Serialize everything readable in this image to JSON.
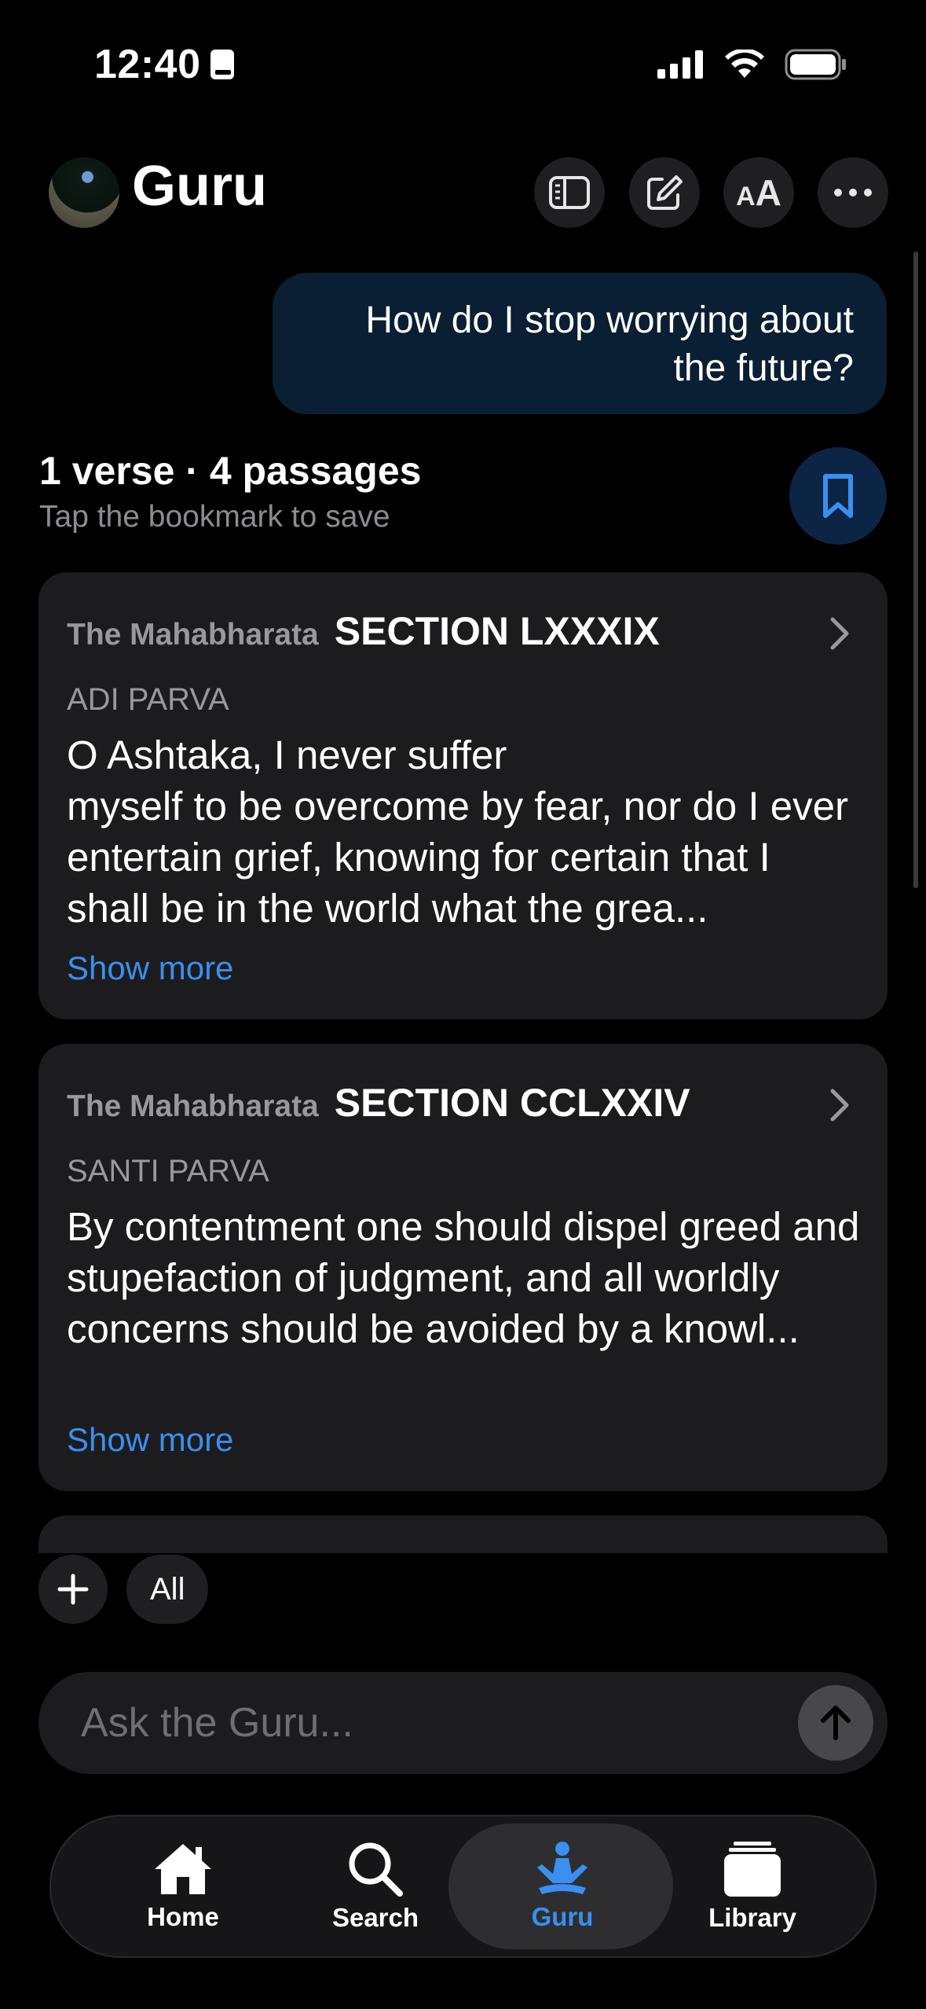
{
  "status_bar": {
    "time": "12:40"
  },
  "header": {
    "title": "Guru",
    "buttons": [
      "sidebar-icon",
      "compose-icon",
      "text-size-icon",
      "more-icon"
    ],
    "text_size_label": "AA"
  },
  "conversation": {
    "user_message": "How do I stop worrying about the future?"
  },
  "results": {
    "summary": "1 verse · 4 passages",
    "hint": "Tap the bookmark to save",
    "cards": [
      {
        "book": "The Mahabharata",
        "section": "SECTION LXXXIX",
        "parva": "ADI PARVA",
        "text": "O Ashtaka, I never suffer\nmyself to be overcome by fear, nor do I ever entertain grief, knowing for certain that I shall be in the world what the grea...",
        "show_more": "Show more"
      },
      {
        "book": "The Mahabharata",
        "section": "SECTION CCLXXIV",
        "parva": "SANTI PARVA",
        "text": "By contentment one should dispel greed and\nstupefaction of judgment, and all worldly concerns should be avoided by a knowl...",
        "show_more": "Show more"
      }
    ]
  },
  "filters": {
    "add_icon": "plus-icon",
    "all_label": "All"
  },
  "composer": {
    "placeholder": "Ask the Guru..."
  },
  "tabbar": {
    "active": "Guru",
    "accent": "#3a8ff0",
    "tabs": [
      {
        "label": "Home",
        "icon": "home-icon"
      },
      {
        "label": "Search",
        "icon": "search-icon"
      },
      {
        "label": "Guru",
        "icon": "meditation-icon"
      },
      {
        "label": "Library",
        "icon": "library-icon"
      }
    ]
  }
}
